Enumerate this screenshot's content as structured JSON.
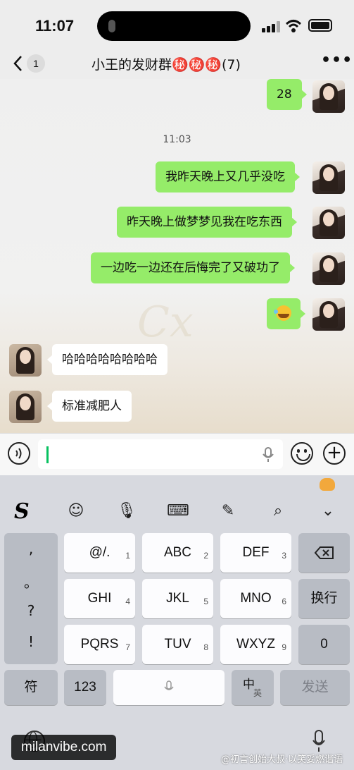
{
  "status_bar": {
    "time": "11:07"
  },
  "header": {
    "back_count": "1",
    "title": "小王的发财群㊙️㊙️㊙️(7)",
    "more": "•••"
  },
  "chat": {
    "timestamp": "11:03",
    "messages": [
      {
        "side": "right",
        "text": "28"
      },
      {
        "side": "right",
        "text": "我昨天晚上又几乎没吃"
      },
      {
        "side": "right",
        "text": "昨天晚上做梦梦见我在吃东西"
      },
      {
        "side": "right",
        "text": "一边吃一边还在后悔完了又破功了"
      },
      {
        "side": "right",
        "text": "",
        "emoji": "laughing-crying-emoji"
      },
      {
        "side": "left",
        "text": "哈哈哈哈哈哈哈哈"
      },
      {
        "side": "left",
        "text": "标准减肥人"
      }
    ],
    "watermark": "Cx"
  },
  "input_bar": {
    "value": ""
  },
  "keyboard": {
    "brand": "S",
    "punctuation": [
      ",",
      "。",
      "?",
      "!"
    ],
    "keys": [
      {
        "label": "@/.",
        "num": "1"
      },
      {
        "label": "ABC",
        "num": "2"
      },
      {
        "label": "DEF",
        "num": "3"
      },
      {
        "label": "GHI",
        "num": "4"
      },
      {
        "label": "JKL",
        "num": "5"
      },
      {
        "label": "MNO",
        "num": "6"
      },
      {
        "label": "PQRS",
        "num": "7"
      },
      {
        "label": "TUV",
        "num": "8"
      },
      {
        "label": "WXYZ",
        "num": "9"
      }
    ],
    "newline": "换行",
    "zero": "0",
    "symbol": "符",
    "numbers": "123",
    "lang_main": "中",
    "lang_sub": "英",
    "send": "发送"
  },
  "overlay": {
    "site": "milanvibe.com",
    "weibo": "@初言创始大叔·以笑妥燃谐语"
  }
}
